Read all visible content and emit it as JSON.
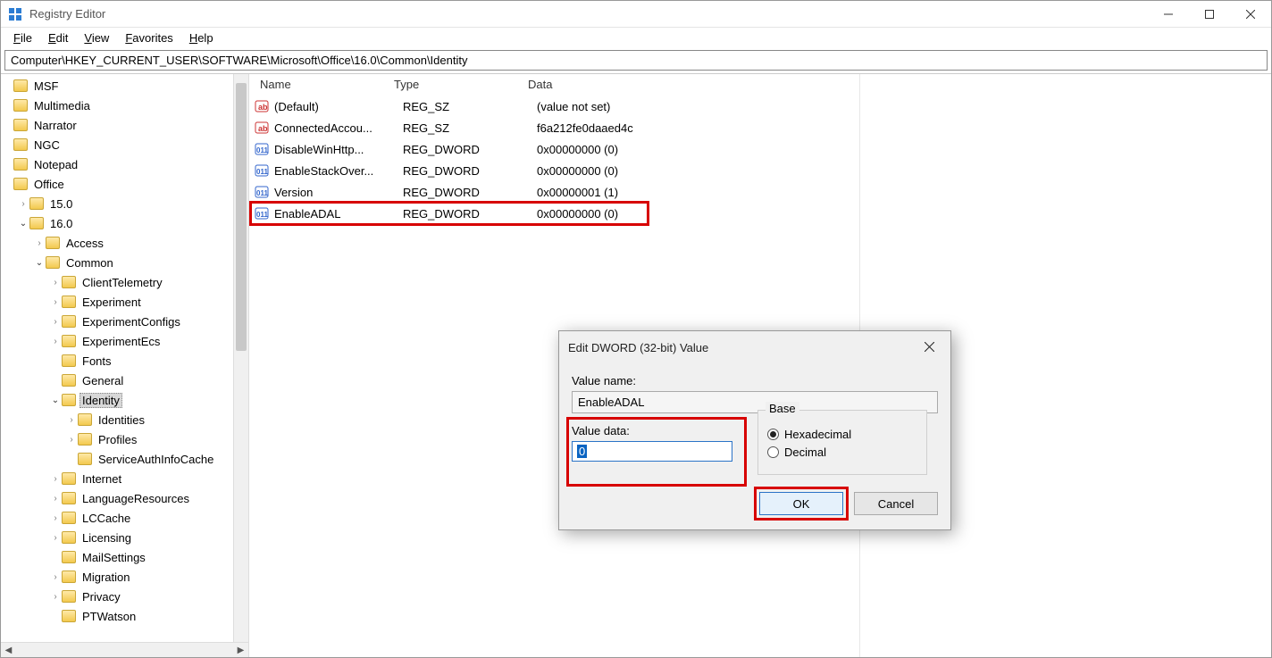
{
  "app": {
    "title": "Registry Editor"
  },
  "menu": {
    "file": "File",
    "edit": "Edit",
    "view": "View",
    "favorites": "Favorites",
    "help": "Help"
  },
  "address": "Computer\\HKEY_CURRENT_USER\\SOFTWARE\\Microsoft\\Office\\16.0\\Common\\Identity",
  "tree": [
    {
      "indent": 0,
      "chev": "",
      "label": "MSF"
    },
    {
      "indent": 0,
      "chev": "",
      "label": "Multimedia"
    },
    {
      "indent": 0,
      "chev": "",
      "label": "Narrator"
    },
    {
      "indent": 0,
      "chev": "",
      "label": "NGC"
    },
    {
      "indent": 0,
      "chev": "",
      "label": "Notepad"
    },
    {
      "indent": 0,
      "chev": "",
      "label": "Office"
    },
    {
      "indent": 1,
      "chev": ">",
      "label": "15.0"
    },
    {
      "indent": 1,
      "chev": "v",
      "label": "16.0"
    },
    {
      "indent": 2,
      "chev": ">",
      "label": "Access"
    },
    {
      "indent": 2,
      "chev": "v",
      "label": "Common"
    },
    {
      "indent": 3,
      "chev": ">",
      "label": "ClientTelemetry"
    },
    {
      "indent": 3,
      "chev": ">",
      "label": "Experiment"
    },
    {
      "indent": 3,
      "chev": ">",
      "label": "ExperimentConfigs"
    },
    {
      "indent": 3,
      "chev": ">",
      "label": "ExperimentEcs"
    },
    {
      "indent": 3,
      "chev": "",
      "label": "Fonts"
    },
    {
      "indent": 3,
      "chev": "",
      "label": "General"
    },
    {
      "indent": 3,
      "chev": "v",
      "label": "Identity",
      "selected": true
    },
    {
      "indent": 4,
      "chev": ">",
      "label": "Identities"
    },
    {
      "indent": 4,
      "chev": ">",
      "label": "Profiles"
    },
    {
      "indent": 4,
      "chev": "",
      "label": "ServiceAuthInfoCache"
    },
    {
      "indent": 3,
      "chev": ">",
      "label": "Internet"
    },
    {
      "indent": 3,
      "chev": ">",
      "label": "LanguageResources"
    },
    {
      "indent": 3,
      "chev": ">",
      "label": "LCCache"
    },
    {
      "indent": 3,
      "chev": ">",
      "label": "Licensing"
    },
    {
      "indent": 3,
      "chev": "",
      "label": "MailSettings"
    },
    {
      "indent": 3,
      "chev": ">",
      "label": "Migration"
    },
    {
      "indent": 3,
      "chev": ">",
      "label": "Privacy"
    },
    {
      "indent": 3,
      "chev": "",
      "label": "PTWatson"
    }
  ],
  "list": {
    "headers": {
      "name": "Name",
      "type": "Type",
      "data": "Data"
    },
    "rows": [
      {
        "icon": "sz",
        "name": "(Default)",
        "type": "REG_SZ",
        "data": "(value not set)"
      },
      {
        "icon": "sz",
        "name": "ConnectedAccou...",
        "type": "REG_SZ",
        "data": "f6a212fe0daaed4c"
      },
      {
        "icon": "dw",
        "name": "DisableWinHttp...",
        "type": "REG_DWORD",
        "data": "0x00000000 (0)"
      },
      {
        "icon": "dw",
        "name": "EnableStackOver...",
        "type": "REG_DWORD",
        "data": "0x00000000 (0)"
      },
      {
        "icon": "dw",
        "name": "Version",
        "type": "REG_DWORD",
        "data": "0x00000001 (1)"
      },
      {
        "icon": "dw",
        "name": "EnableADAL",
        "type": "REG_DWORD",
        "data": "0x00000000 (0)",
        "highlighted": true
      }
    ]
  },
  "dialog": {
    "title": "Edit DWORD (32-bit) Value",
    "value_name_label": "Value name:",
    "value_name": "EnableADAL",
    "value_data_label": "Value data:",
    "value_data": "0",
    "base_label": "Base",
    "hex_label": "Hexadecimal",
    "dec_label": "Decimal",
    "base_selected": "hex",
    "ok": "OK",
    "cancel": "Cancel"
  }
}
